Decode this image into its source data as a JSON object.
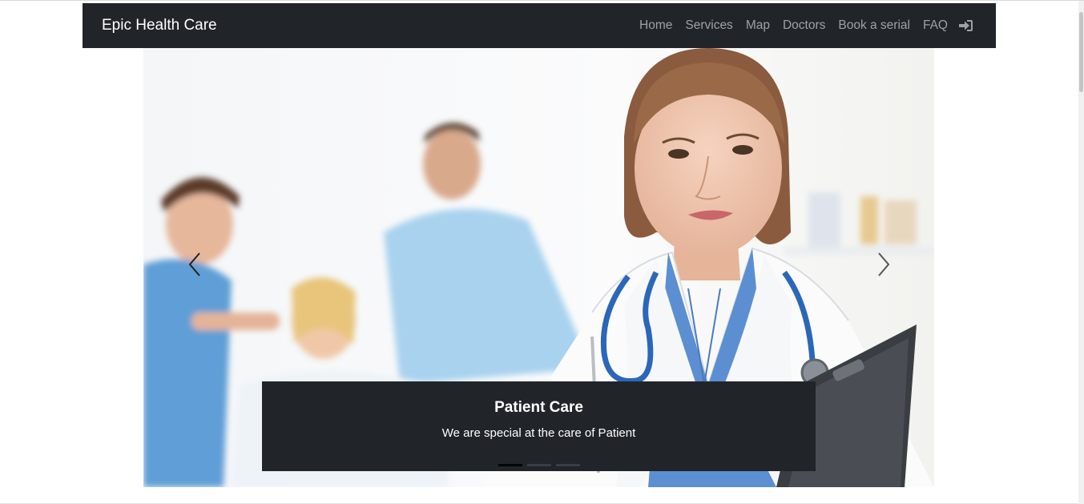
{
  "navbar": {
    "brand": "Epic Health Care",
    "links": [
      "Home",
      "Services",
      "Map",
      "Doctors",
      "Book a serial",
      "FAQ"
    ],
    "login_icon": "sign-in-icon"
  },
  "carousel": {
    "caption_title": "Patient Care",
    "caption_text": "We are special at the care of Patient",
    "indicator_count": 3,
    "active_indicator": 1,
    "prev_icon": "chevron-left-icon",
    "next_icon": "chevron-right-icon"
  },
  "colors": {
    "navbar_bg": "#212529",
    "nav_link": "#9ca2a8",
    "brand": "#ffffff",
    "caption_bg": "#212529"
  }
}
